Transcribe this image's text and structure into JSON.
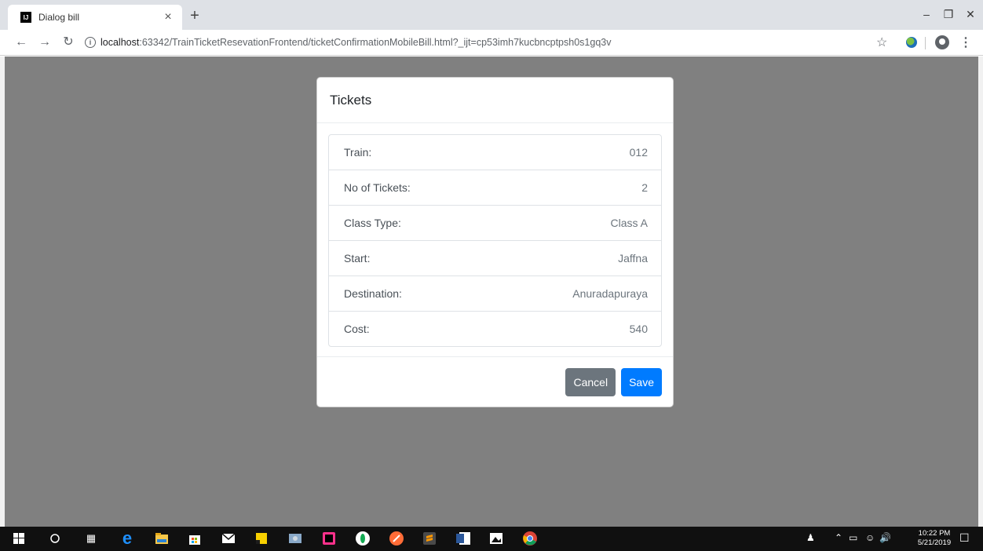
{
  "browser": {
    "tab_title": "Dialog bill",
    "tab_close": "×",
    "new_tab": "+",
    "url_host": "localhost",
    "url_rest": ":63342/TrainTicketResevationFrontend/ticketConfirmationMobileBill.html?_ijt=cp53imh7kucbncptpsh0s1gq3v",
    "icons": [
      "back-icon",
      "forward-icon",
      "reload-icon",
      "info-icon",
      "star-icon",
      "extension-icon",
      "profile-icon",
      "menu-icon"
    ]
  },
  "modal": {
    "title": "Tickets",
    "rows": [
      {
        "label": "Train:",
        "value": "012"
      },
      {
        "label": "No of Tickets:",
        "value": "2"
      },
      {
        "label": "Class Type:",
        "value": "Class A"
      },
      {
        "label": "Start:",
        "value": "Jaffna"
      },
      {
        "label": "Destination:",
        "value": "Anuradapuraya"
      },
      {
        "label": "Cost:",
        "value": "540"
      }
    ],
    "cancel_label": "Cancel",
    "save_label": "Save"
  },
  "taskbar": {
    "time": "10:22 PM",
    "date": "5/21/2019"
  },
  "colors": {
    "backdrop": "#808080",
    "primary": "#007bff",
    "secondary": "#6c757d"
  }
}
